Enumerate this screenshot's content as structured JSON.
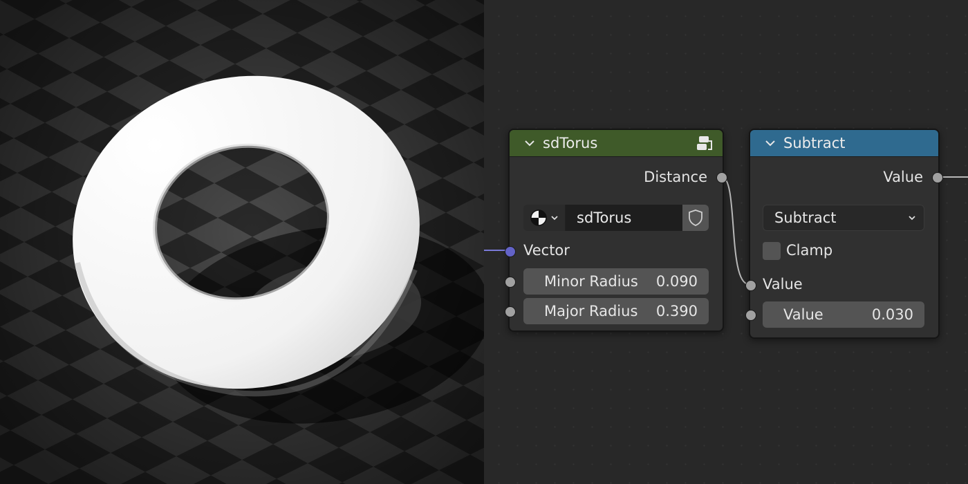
{
  "viewport": {
    "scene": "torus-render"
  },
  "nodes": {
    "sdtorus": {
      "title": "sdTorus",
      "header_color": "#3f5a29",
      "output_label": "Distance",
      "selector_name": "sdTorus",
      "input_vector_label": "Vector",
      "minor_radius_label": "Minor Radius",
      "minor_radius_value": "0.090",
      "major_radius_label": "Major Radius",
      "major_radius_value": "0.390"
    },
    "subtract": {
      "title": "Subtract",
      "header_color": "#2f6a8f",
      "output_label": "Value",
      "operation": "Subtract",
      "clamp_label": "Clamp",
      "clamp_checked": false,
      "input1_label": "Value",
      "input2_label": "Value",
      "input2_value": "0.030"
    }
  },
  "colors": {
    "socket_float": "#a1a1a1",
    "socket_vector": "#6363c7",
    "link": "#b8b8b8",
    "vector_link": "#7a7ad8"
  }
}
